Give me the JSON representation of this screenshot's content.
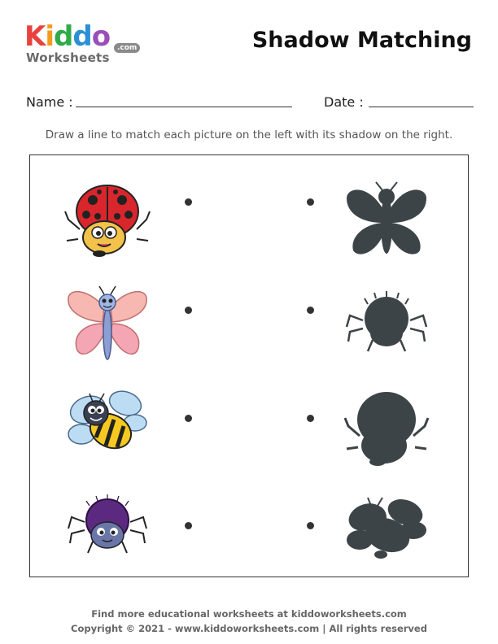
{
  "logo": {
    "letters": [
      {
        "ch": "K",
        "color": "#e8423f"
      },
      {
        "ch": "i",
        "color": "#f29b1e"
      },
      {
        "ch": "d",
        "color": "#2faa4a"
      },
      {
        "ch": "d",
        "color": "#2b8fd6"
      },
      {
        "ch": "o",
        "color": "#9a4fb8"
      }
    ],
    "subtitle": "Worksheets",
    "badge": ".com"
  },
  "title": "Shadow Matching",
  "fields": {
    "name_label": "Name :",
    "date_label": "Date :"
  },
  "instructions": "Draw a line to match each picture on the left with its shadow on the right.",
  "left_pictures": [
    "ladybug-icon",
    "butterfly-icon",
    "bee-icon",
    "spider-icon"
  ],
  "right_shadows": [
    "butterfly-shadow",
    "spider-shadow",
    "ladybug-shadow",
    "bee-shadow"
  ],
  "colors": {
    "shadow": "#3d4448",
    "dot": "#333333"
  },
  "footer": {
    "line1": "Find more educational worksheets at kiddoworksheets.com",
    "line2": "Copyright © 2021 - www.kiddoworksheets.com  |  All rights reserved"
  }
}
